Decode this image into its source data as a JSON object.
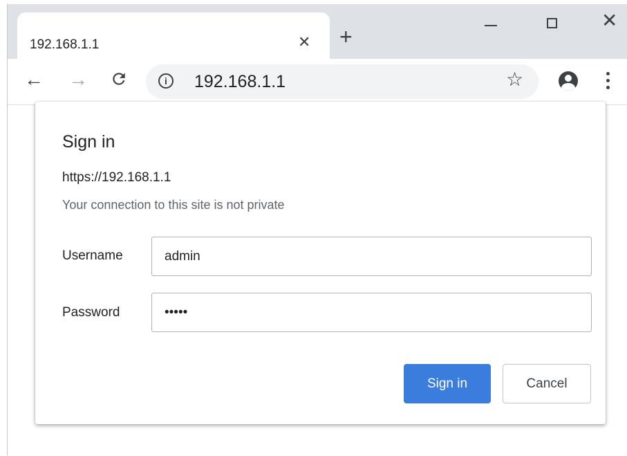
{
  "tab": {
    "title": "192.168.1.1",
    "close_icon": "close-icon",
    "new_tab_icon": "plus-icon"
  },
  "window_controls": {
    "minimize_icon": "minimize-icon",
    "maximize_icon": "maximize-icon",
    "close_icon": "close-icon"
  },
  "toolbar": {
    "back_icon": "arrow-left-icon",
    "forward_icon": "arrow-right-icon",
    "reload_icon": "reload-icon",
    "info_icon": "info-icon",
    "url": "192.168.1.1",
    "bookmark_icon": "star-icon",
    "profile_icon": "account-circle-icon",
    "menu_icon": "more-vert-icon"
  },
  "dialog": {
    "title": "Sign in",
    "origin": "https://192.168.1.1",
    "warning": "Your connection to this site is not private",
    "username_label": "Username",
    "username_value": "admin",
    "password_label": "Password",
    "password_value": "admin",
    "sign_in_label": "Sign in",
    "cancel_label": "Cancel"
  },
  "colors": {
    "primary_button": "#3b7ddd",
    "tabstrip": "#dee1e6",
    "omnibox": "#f1f3f4"
  }
}
